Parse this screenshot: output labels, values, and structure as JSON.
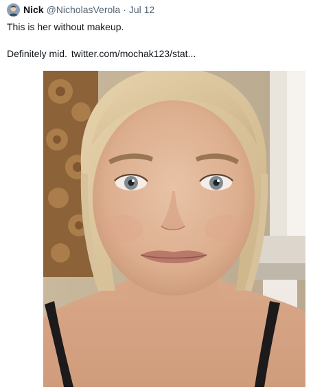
{
  "tweet": {
    "display_name": "Nick",
    "handle": "@NicholasVerola",
    "separator": "·",
    "date": "Jul 12",
    "text_line1": "This is her without makeup.",
    "text_line2": "Definitely mid.",
    "link_text": "twitter.com/mochak123/stat..."
  },
  "icons": {
    "avatar": "user-avatar"
  },
  "colors": {
    "text_primary": "#0f1419",
    "text_secondary": "#536471"
  }
}
